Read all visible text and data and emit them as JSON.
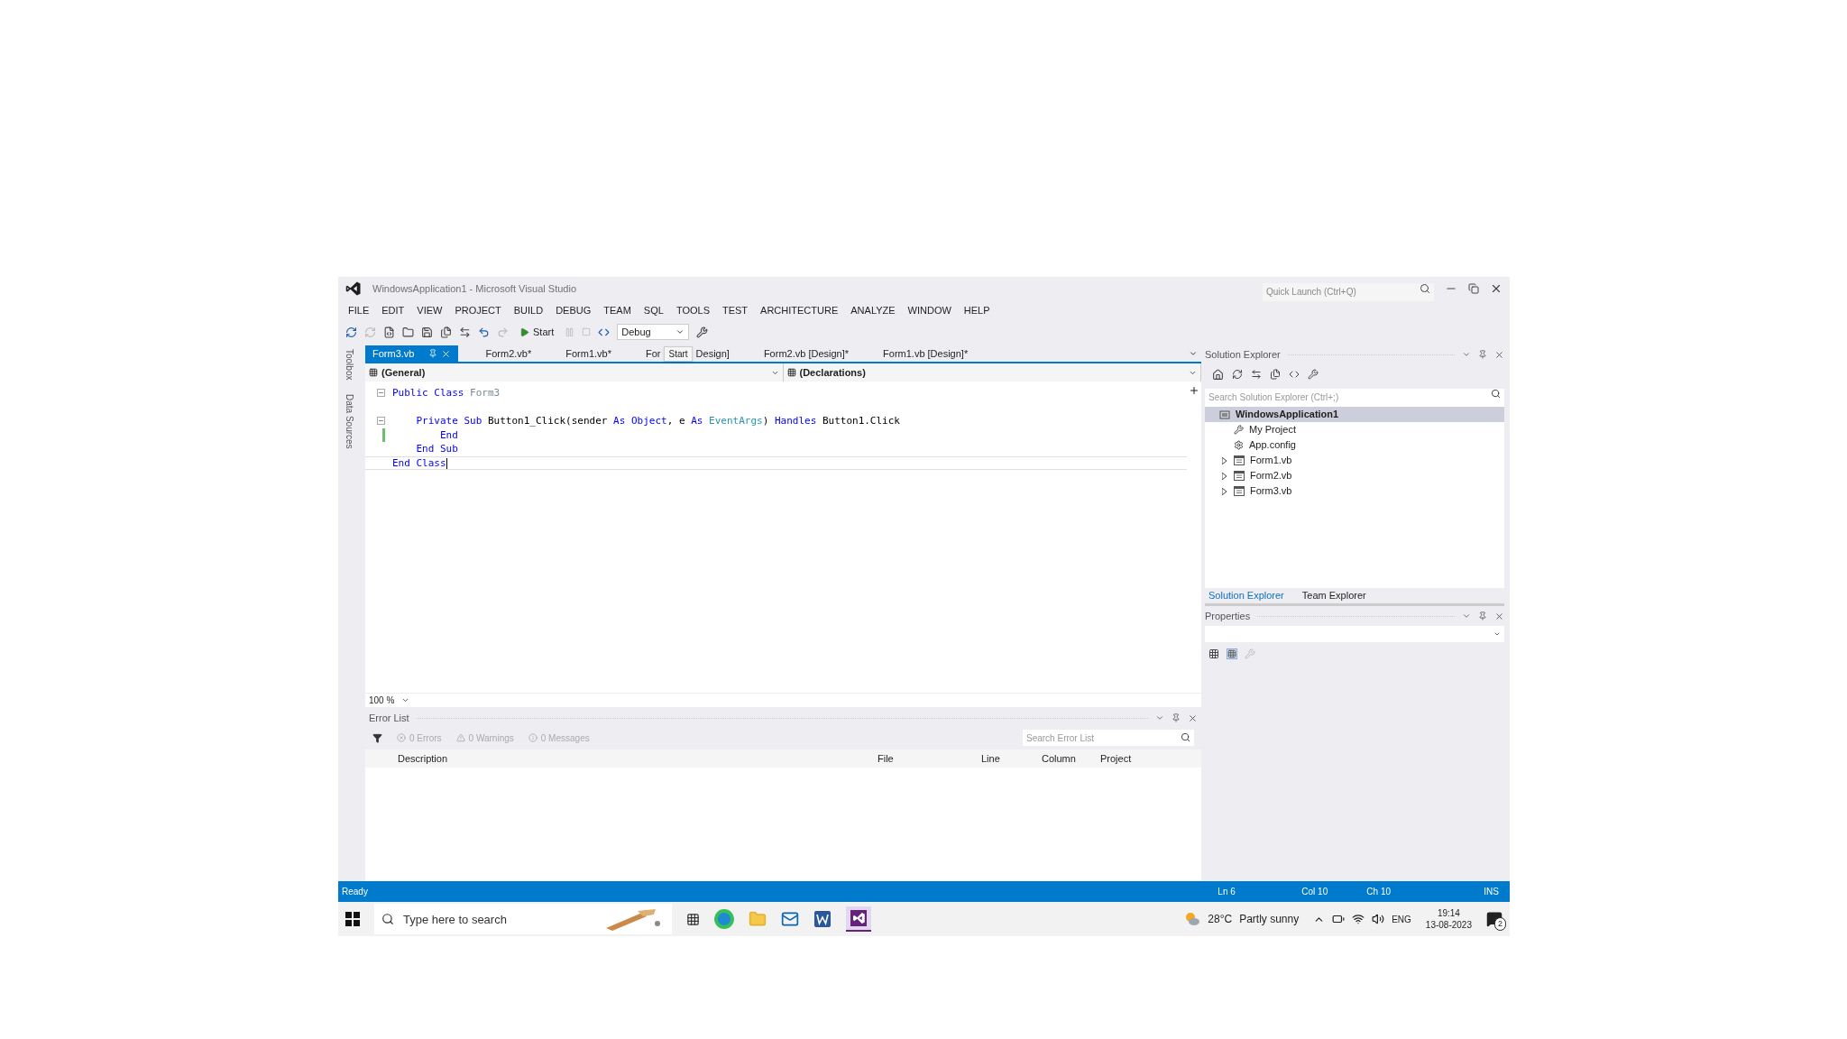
{
  "window": {
    "title": "WindowsApplication1 - Microsoft Visual Studio",
    "quick_launch": {
      "placeholder": "Quick Launch (Ctrl+Q)"
    }
  },
  "menu": [
    "FILE",
    "EDIT",
    "VIEW",
    "PROJECT",
    "BUILD",
    "DEBUG",
    "TEAM",
    "SQL",
    "TOOLS",
    "TEST",
    "ARCHITECTURE",
    "ANALYZE",
    "WINDOW",
    "HELP"
  ],
  "toolbar": {
    "start": "Start",
    "configuration": "Debug"
  },
  "side_strip": [
    "Toolbox",
    "Data Sources"
  ],
  "tabs": [
    {
      "label": "Form3.vb",
      "selected": true,
      "pinned": true
    },
    {
      "label": "Form2.vb*",
      "selected": false,
      "pinned": false
    },
    {
      "label": "Form1.vb*",
      "selected": false,
      "pinned": false
    },
    {
      "label": "For",
      "label_end": "Design]",
      "tooltip": "Start",
      "selected": false,
      "pinned": false
    },
    {
      "label": "Form2.vb [Design]*",
      "selected": false,
      "pinned": false
    },
    {
      "label": "Form1.vb [Design]*",
      "selected": false,
      "pinned": false
    }
  ],
  "nav_bar": [
    "(General)",
    "(Declarations)"
  ],
  "code": [
    {
      "kind": "code",
      "fold": true,
      "changed": false,
      "current": false,
      "tokens": [
        {
          "kind": "keyword",
          "text": "Public Class"
        },
        {
          "kind": "classname",
          "text": "Form3"
        }
      ],
      "children": [
        {
          "kind": "blank"
        },
        {
          "kind": "code",
          "fold": true,
          "changed": false,
          "current": false,
          "tokens": [
            {
              "kind": "keyword",
              "text": "Private Sub"
            },
            {
              "kind": "plain",
              "text": "Button1_Click(sender"
            },
            {
              "kind": "keyword",
              "text": "As Object"
            },
            {
              "kind": "plain",
              "text": ", e",
              "glue": true
            },
            {
              "kind": "keyword",
              "text": "As"
            },
            {
              "kind": "type",
              "text": "EventArgs"
            },
            {
              "kind": "plain",
              "text": ")",
              "glue": true
            },
            {
              "kind": "keyword",
              "text": "Handles"
            },
            {
              "kind": "plain",
              "text": "Button1.Click"
            }
          ],
          "children": [
            {
              "kind": "code",
              "fold": false,
              "changed": true,
              "current": false,
              "tokens": [
                {
                  "kind": "keyword",
                  "text": "End"
                }
              ]
            }
          ]
        },
        {
          "kind": "code",
          "fold": false,
          "changed": false,
          "current": false,
          "tokens": [
            {
              "kind": "keyword",
              "text": "End Sub"
            }
          ]
        }
      ]
    },
    {
      "kind": "code",
      "fold": false,
      "changed": false,
      "current": true,
      "tokens": [
        {
          "kind": "keyword",
          "text": "End Class"
        }
      ]
    }
  ],
  "zoom": "100 %",
  "error_list": {
    "title": "Error List",
    "filters": [
      "0 Errors",
      "0 Warnings",
      "0 Messages"
    ],
    "search": {
      "placeholder": "Search Error List"
    },
    "columns": [
      "Description",
      "File",
      "Line",
      "Column",
      "Project"
    ]
  },
  "solution_explorer": {
    "title": "Solution Explorer",
    "search": {
      "placeholder": "Search Solution Explorer (Ctrl+;)"
    },
    "tree": [
      {
        "label": "WindowsApplication1",
        "kind": "solution",
        "selected": true,
        "children": [
          {
            "label": "My Project",
            "kind": "wrench",
            "selected": false
          },
          {
            "label": "App.config",
            "kind": "config",
            "selected": false
          },
          {
            "label": "Form1.vb",
            "kind": "form",
            "selected": false,
            "expanded": false
          },
          {
            "label": "Form2.vb",
            "kind": "form",
            "selected": false,
            "expanded": false
          },
          {
            "label": "Form3.vb",
            "kind": "form",
            "selected": false,
            "expanded": false
          }
        ]
      }
    ],
    "tabs": [
      {
        "label": "Solution Explorer",
        "selected": true
      },
      {
        "label": "Team Explorer",
        "selected": false
      }
    ]
  },
  "properties": {
    "title": "Properties"
  },
  "status_bar": {
    "status": "Ready",
    "line": "Ln 6",
    "column": "Col 10",
    "char": "Ch 10",
    "mode": "INS"
  },
  "taskbar": {
    "search": {
      "placeholder": "Type here to search"
    },
    "temperature": "28°C",
    "weather": "Partly sunny",
    "language": "ENG",
    "time": "19:14",
    "date": "13-08-2023",
    "notifications": "2"
  }
}
